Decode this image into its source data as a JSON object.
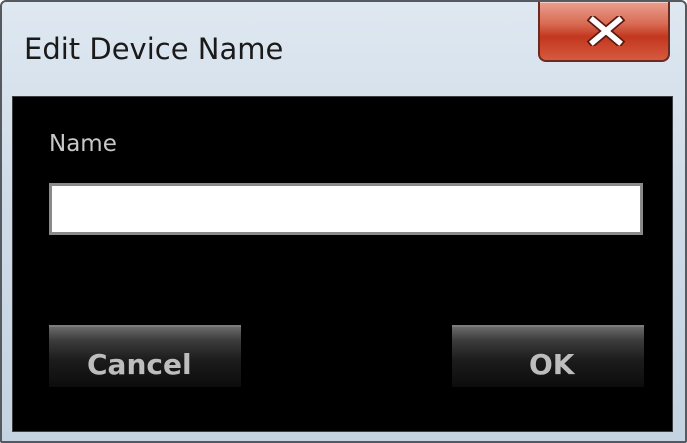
{
  "window": {
    "title": "Edit Device Name"
  },
  "form": {
    "name_label": "Name",
    "name_value": "",
    "name_placeholder": ""
  },
  "buttons": {
    "cancel_label": "Cancel",
    "ok_label": "OK"
  },
  "icons": {
    "close": "close-icon"
  },
  "colors": {
    "client_background": "#000000",
    "close_button": "#c2371f",
    "button_text": "#bdbdbd",
    "label_text": "#c8c8c8"
  }
}
